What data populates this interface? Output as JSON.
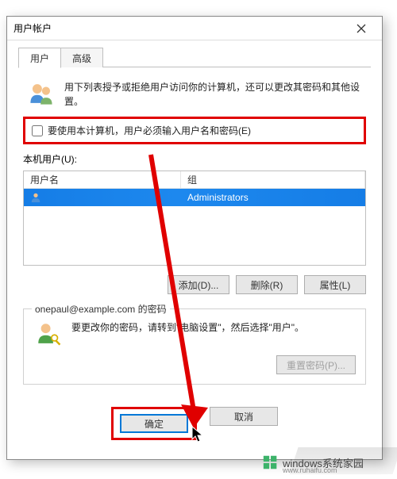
{
  "dialog": {
    "title": "用户帐户"
  },
  "tabs": {
    "user": "用户",
    "advanced": "高级"
  },
  "intro": "用下列表授予或拒绝用户访问你的计算机，还可以更改其密码和其他设置。",
  "require_login_label": "要使用本计算机，用户必须输入用户名和密码(E)",
  "local_users_label": "本机用户(U):",
  "columns": {
    "name": "用户名",
    "group": "组"
  },
  "row": {
    "name": "",
    "group": "Administrators"
  },
  "buttons": {
    "add": "添加(D)...",
    "remove": "删除(R)",
    "properties": "属性(L)"
  },
  "password_box": {
    "title": "onepaul@example.com 的密码",
    "text": "要更改你的密码，请转到\"电脑设置\"，然后选择\"用户\"。",
    "reset": "重置密码(P)..."
  },
  "dlg_buttons": {
    "ok": "确定",
    "cancel": "取消"
  },
  "watermark": {
    "main": "windows系统家园",
    "sub": "www.ruhaifu.com"
  }
}
